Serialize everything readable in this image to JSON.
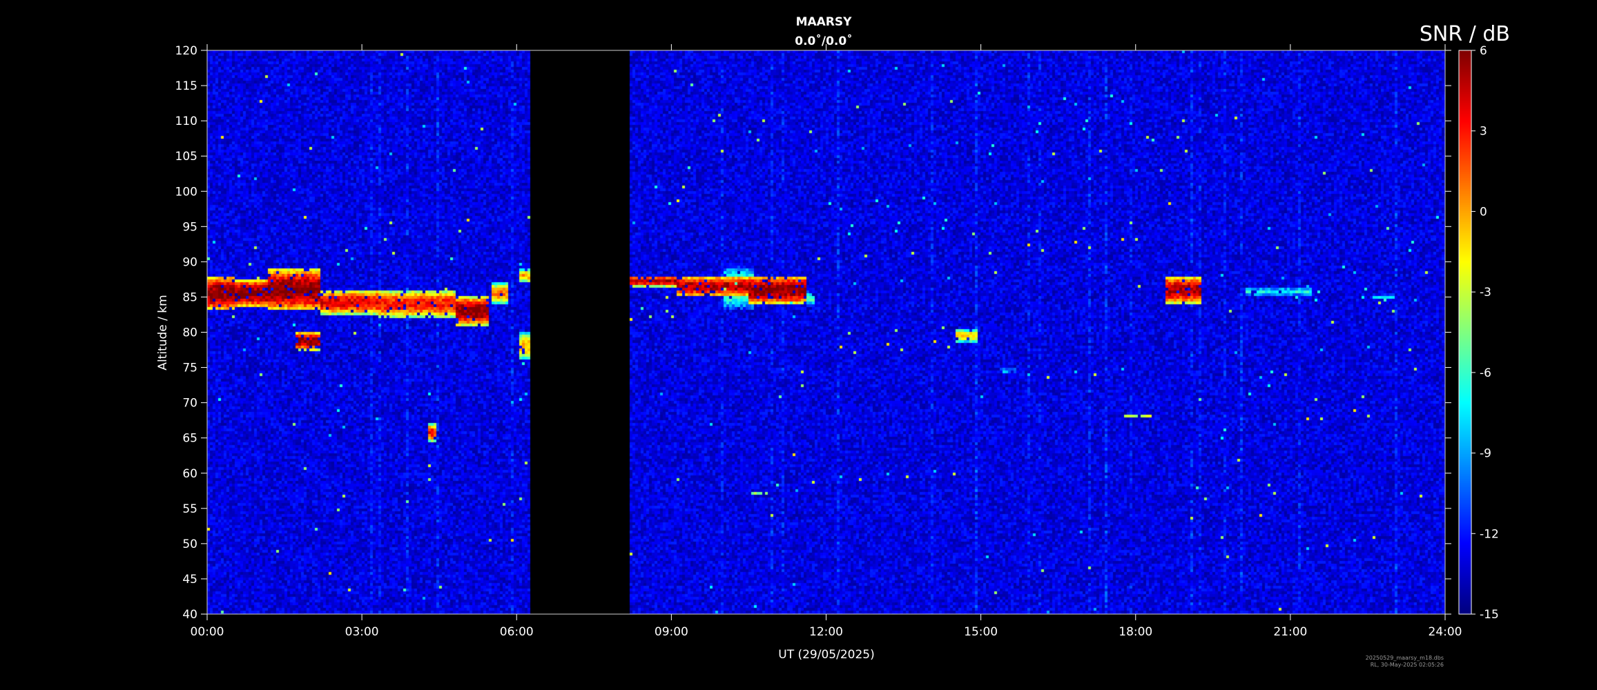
{
  "chart_data": {
    "type": "heatmap",
    "title": "MAARSY",
    "subtitle": "0.0˚/0.0˚",
    "xlabel": "UT (29/05/2025)",
    "ylabel": "Altitude / km",
    "xlim": [
      0,
      24
    ],
    "ylim": [
      40,
      120
    ],
    "x_tick_labels": [
      "00:00",
      "03:00",
      "06:00",
      "09:00",
      "12:00",
      "15:00",
      "18:00",
      "21:00",
      "24:00"
    ],
    "y_ticks": [
      40,
      45,
      50,
      55,
      60,
      65,
      70,
      75,
      80,
      85,
      90,
      95,
      100,
      105,
      110,
      115,
      120
    ],
    "colorbar": {
      "label": "SNR / dB",
      "range": [
        -15,
        6
      ],
      "ticks": [
        6,
        3,
        0,
        -3,
        -6,
        -9,
        -12,
        -15
      ],
      "colormap": "jet",
      "colors": [
        "#00008f",
        "#0000ff",
        "#0080ff",
        "#00ffff",
        "#80ff80",
        "#ffff00",
        "#ff8000",
        "#ff0000",
        "#800000"
      ]
    },
    "background_snr_db": -13,
    "data_gap": {
      "t_start": 6.27,
      "t_end": 8.18
    },
    "echo_regions": [
      {
        "t": [
          0.0,
          0.55
        ],
        "z": [
          83,
          88
        ],
        "snr": 6
      },
      {
        "t": [
          0.55,
          1.2
        ],
        "z": [
          83.5,
          87.5
        ],
        "snr": 6
      },
      {
        "t": [
          1.2,
          2.2
        ],
        "z": [
          83,
          89
        ],
        "snr": 6
      },
      {
        "t": [
          1.7,
          2.2
        ],
        "z": [
          77.5,
          80
        ],
        "snr": 6
      },
      {
        "t": [
          2.2,
          3.3
        ],
        "z": [
          82.5,
          86
        ],
        "snr": 4
      },
      {
        "t": [
          3.3,
          4.8
        ],
        "z": [
          82,
          86
        ],
        "snr": 3
      },
      {
        "t": [
          4.8,
          5.45
        ],
        "z": [
          81,
          85
        ],
        "snr": 6
      },
      {
        "t": [
          5.5,
          5.85
        ],
        "z": [
          84,
          87
        ],
        "snr": 1
      },
      {
        "t": [
          6.05,
          6.27
        ],
        "z": [
          76,
          80
        ],
        "snr": 0
      },
      {
        "t": [
          6.05,
          6.27
        ],
        "z": [
          87,
          89
        ],
        "snr": 0
      },
      {
        "t": [
          4.3,
          4.45
        ],
        "z": [
          64.5,
          67
        ],
        "snr": 3
      },
      {
        "t": [
          8.18,
          9.1
        ],
        "z": [
          86.5,
          88
        ],
        "snr": 5
      },
      {
        "t": [
          9.1,
          10.5
        ],
        "z": [
          85,
          88
        ],
        "snr": 5
      },
      {
        "t": [
          10.0,
          10.6
        ],
        "z": [
          83,
          89.5
        ],
        "snr": -4
      },
      {
        "t": [
          10.5,
          11.6
        ],
        "z": [
          84,
          88
        ],
        "snr": 6
      },
      {
        "t": [
          11.6,
          11.8
        ],
        "z": [
          83.5,
          86
        ],
        "snr": -6
      },
      {
        "t": [
          14.5,
          14.95
        ],
        "z": [
          78.5,
          80.5
        ],
        "snr": -1
      },
      {
        "t": [
          15.35,
          15.7
        ],
        "z": [
          74.2,
          74.9
        ],
        "snr": -7
      },
      {
        "t": [
          18.6,
          19.3
        ],
        "z": [
          84,
          88
        ],
        "snr": 5
      },
      {
        "t": [
          20.15,
          21.4
        ],
        "z": [
          85,
          86.5
        ],
        "snr": -7
      },
      {
        "t": [
          22.6,
          23.0
        ],
        "z": [
          84.5,
          85.5
        ],
        "snr": -8
      },
      {
        "t": [
          10.55,
          10.85
        ],
        "z": [
          56.8,
          57.4
        ],
        "snr": -4
      },
      {
        "t": [
          17.8,
          18.3
        ],
        "z": [
          67.8,
          68.4
        ],
        "snr": -3
      }
    ]
  },
  "footer": {
    "line1": "20250529_maarsy_m18.dbs",
    "line2": "RL, 30-May-2025 02:05:26"
  }
}
